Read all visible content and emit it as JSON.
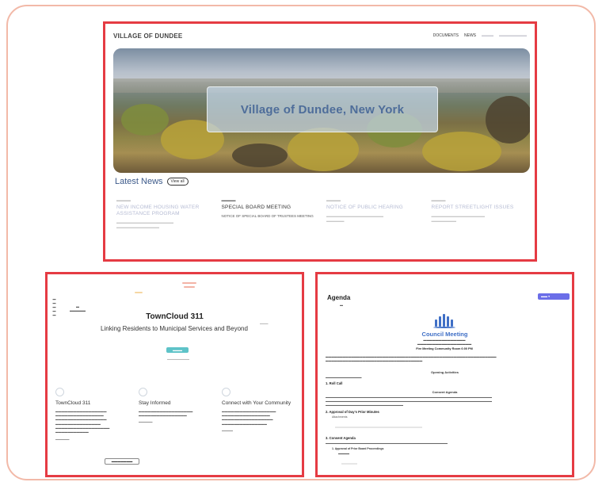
{
  "top_site": {
    "title": "VILLAGE OF DUNDEE",
    "nav": [
      "DOCUMENTS",
      "NEWS"
    ],
    "hero_title": "Village of Dundee, New York",
    "news_label": "Latest News",
    "news_more": "View all",
    "news": [
      {
        "headline": "NEW INCOME HOUSING WATER ASSISTANCE PROGRAM"
      },
      {
        "headline": "SPECIAL BOARD MEETING",
        "body": "NOTICE OF SPECIAL BOARD OF TRUSTEES MEETING"
      },
      {
        "headline": "NOTICE OF PUBLIC HEARING"
      },
      {
        "headline": "REPORT STREETLIGHT ISSUES"
      }
    ]
  },
  "towncloud": {
    "title": "TownCloud 311",
    "subtitle": "Linking Residents to Municipal Services and Beyond",
    "features": [
      {
        "title": "TownCloud 311"
      },
      {
        "title": "Stay Informed"
      },
      {
        "title": "Connect with Your Community"
      }
    ]
  },
  "agenda": {
    "page_title": "Agenda",
    "heading": "Council Meeting",
    "meta_line": "Fire Meeting Community Room 6:00 PM",
    "sections": {
      "opening": "Opening Activities",
      "consent": "Consent Agenda"
    },
    "items": [
      "1. Roll Call",
      "2. Approval of Day's Prior Minutes",
      "3. Consent Agenda"
    ],
    "sub_items": [
      "Attachments",
      "1. Approval of Prior Board Proceedings"
    ]
  }
}
